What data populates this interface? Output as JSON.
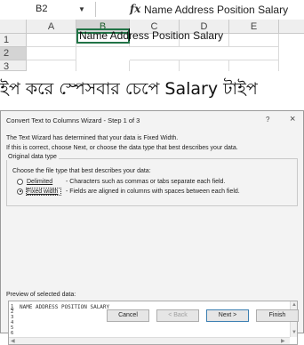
{
  "excel": {
    "name_box": "B2",
    "name_box_arrow": "▼",
    "fx_label": "fx",
    "formula_content": "Name Address Position Salary",
    "columns": [
      "A",
      "B",
      "C",
      "D",
      "E"
    ],
    "rows": [
      "1",
      "2",
      "3"
    ],
    "cell_b2": "Name Address Position Salary",
    "selected_column": "B",
    "selected_row": "2"
  },
  "caption": "ইপ করে স্পেসবার চেপে Salary টাইপ",
  "dialog": {
    "title": "Convert Text to Columns Wizard - Step 1 of 3",
    "help": "?",
    "close": "×",
    "line1": "The Text Wizard has determined that your data is Fixed Width.",
    "line2": "If this is correct, choose Next, or choose the data type that best describes your data.",
    "group_legend": "Original data type",
    "choose_prompt": "Choose the file type that best describes your data:",
    "options": [
      {
        "label": "Delimited",
        "desc": "- Characters such as commas or tabs separate each field.",
        "selected": false
      },
      {
        "label": "Fixed width",
        "desc": "- Fields are aligned in columns with spaces between each field.",
        "selected": true
      }
    ],
    "preview_label": "Preview of selected data:",
    "preview_lines": [
      "NAME ADDRESS POSITION SALARY",
      "",
      "",
      "",
      ""
    ],
    "preview_row_numbers": [
      "1",
      "2",
      "3",
      "4",
      "5",
      "6"
    ],
    "buttons": {
      "cancel": "Cancel",
      "back": "< Back",
      "next": "Next >",
      "finish": "Finish"
    }
  },
  "colors": {
    "excel_accent": "#217346",
    "dialog_bg": "#f3f3f3",
    "default_button_border": "#3c7fb1"
  }
}
